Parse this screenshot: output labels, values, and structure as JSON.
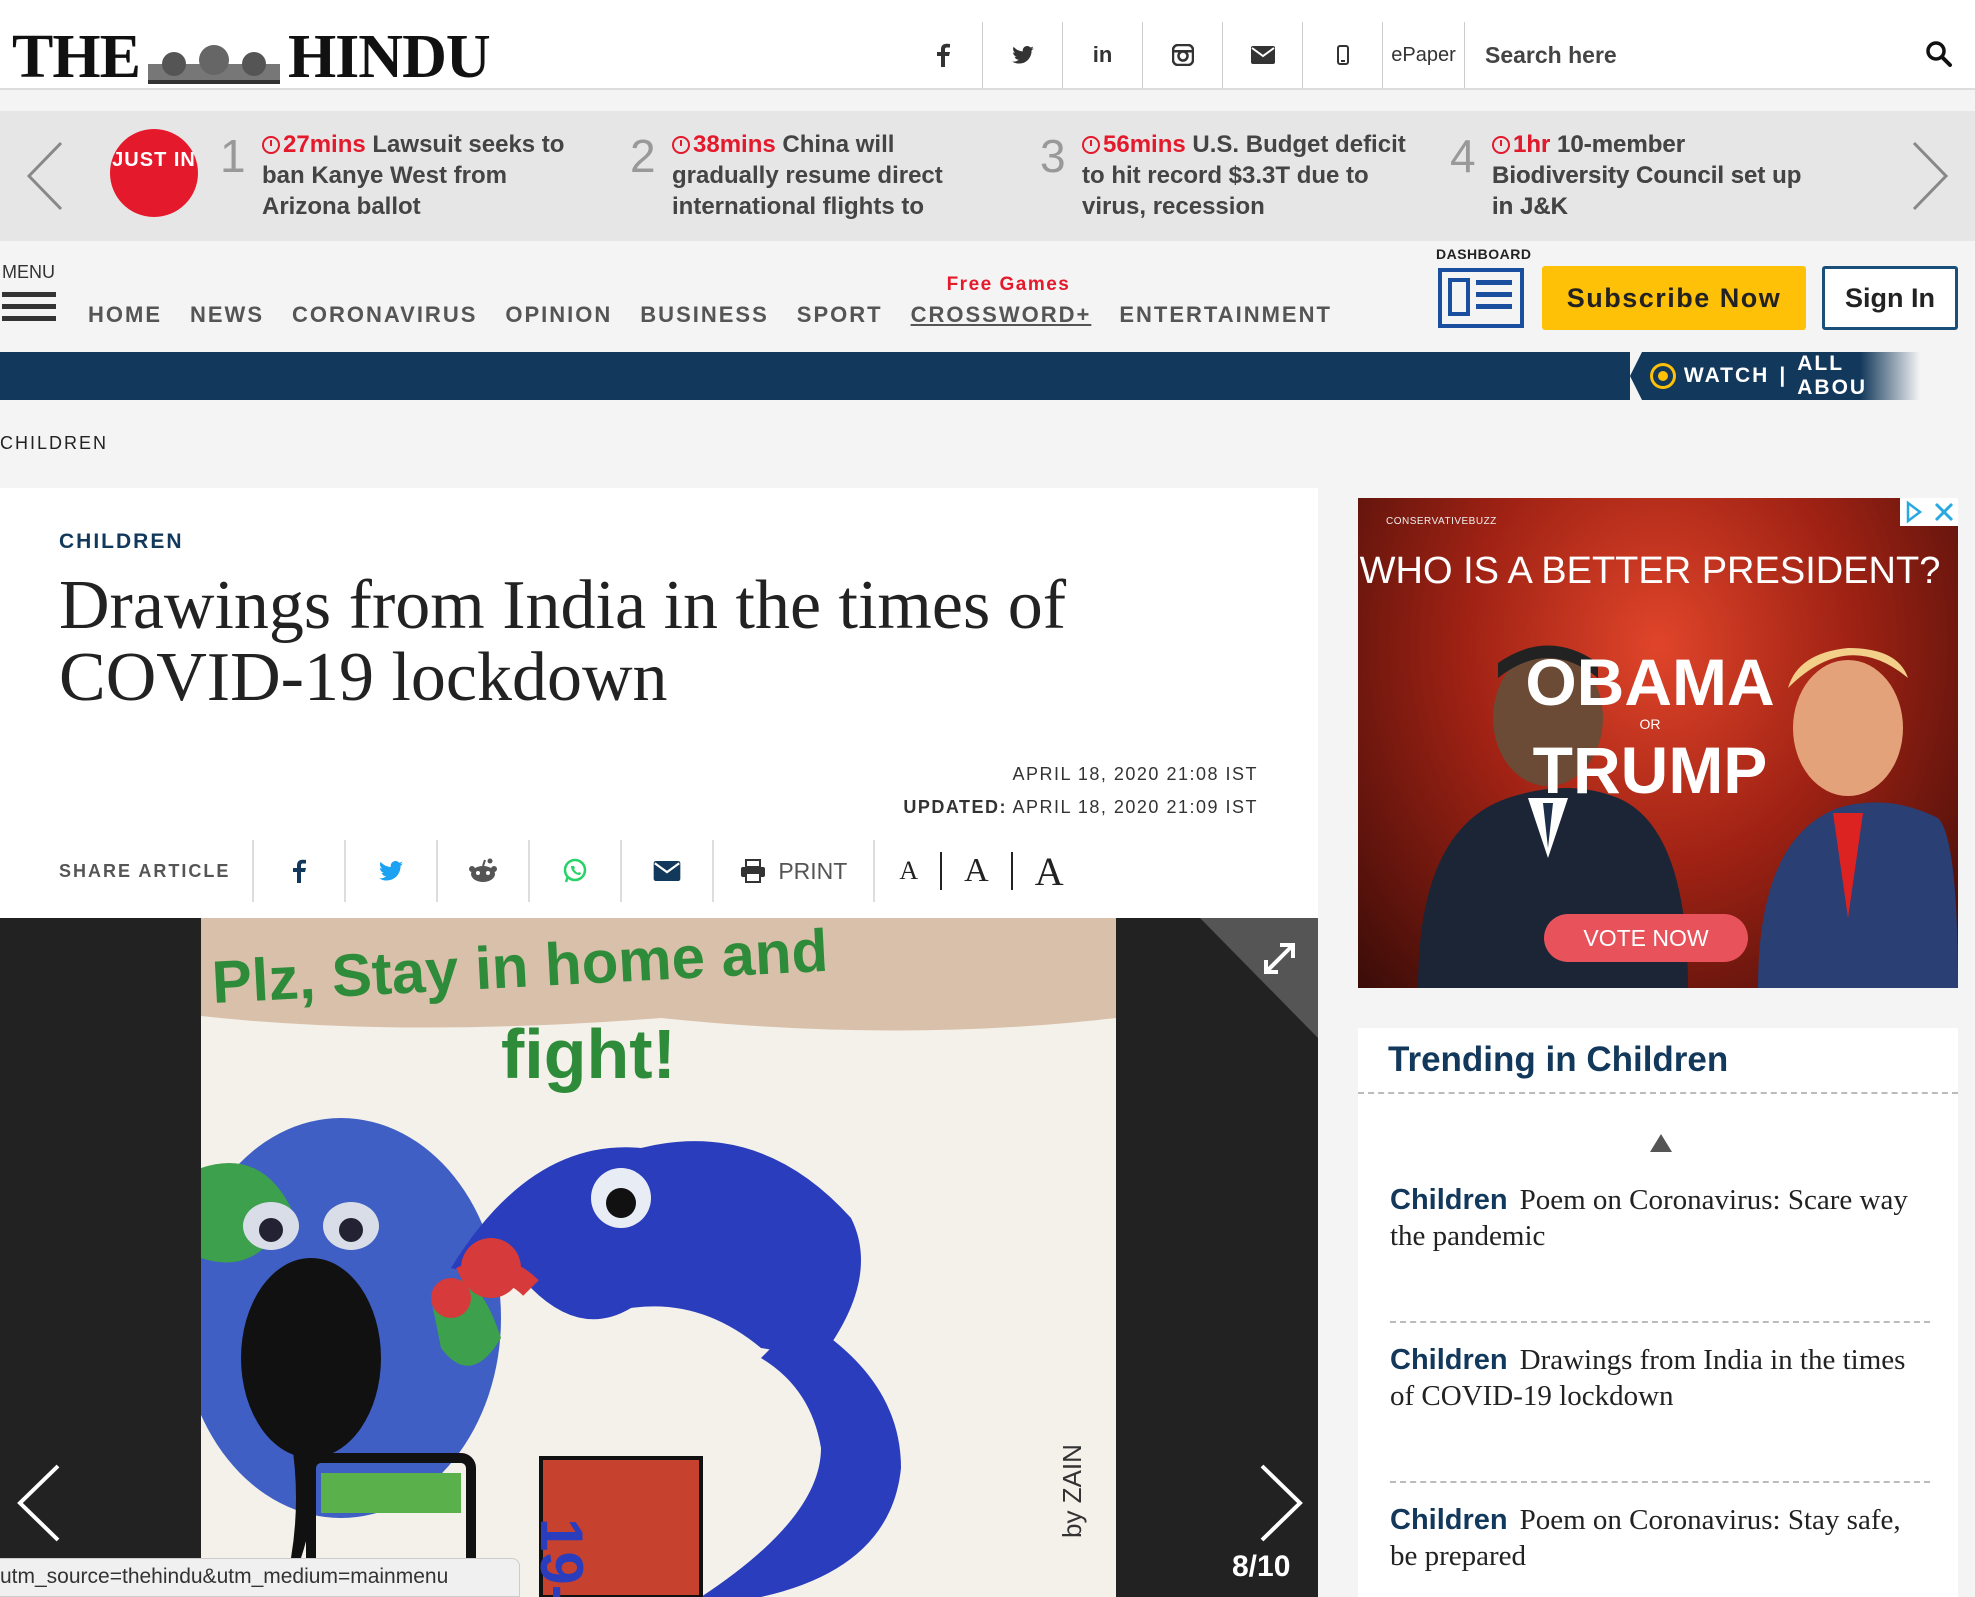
{
  "header": {
    "logo_left": "THE",
    "logo_right": "HINDU",
    "epaper": "ePaper",
    "search_placeholder": "Search here",
    "social_icons": [
      "facebook-icon",
      "twitter-icon",
      "linkedin-icon",
      "instagram-icon",
      "mail-icon",
      "mobile-icon"
    ]
  },
  "ticker": {
    "label": "JUST IN",
    "items": [
      {
        "num": "1",
        "time": "27mins",
        "text": "Lawsuit seeks to ban Kanye West from Arizona ballot"
      },
      {
        "num": "2",
        "time": "38mins",
        "text": "China will gradually resume direct international flights to"
      },
      {
        "num": "3",
        "time": "56mins",
        "text": "U.S. Budget deficit to hit record $3.3T due to virus, recession"
      },
      {
        "num": "4",
        "time": "1hr",
        "text": "10-member Biodiversity Council set up in J&K"
      }
    ]
  },
  "nav": {
    "menu_label": "MENU",
    "items": [
      "HOME",
      "NEWS",
      "CORONAVIRUS",
      "OPINION",
      "BUSINESS",
      "SPORT",
      "CROSSWORD+",
      "ENTERTAINMENT"
    ],
    "crossword_tag": "Free Games",
    "dashboard_label": "DASHBOARD",
    "subscribe": "Subscribe Now",
    "signin": "Sign In",
    "watch": "WATCH",
    "watch_more": "ALL ABOU"
  },
  "breadcrumb": "CHILDREN",
  "article": {
    "section": "CHILDREN",
    "title": "Drawings from India in the times of COVID-19 lockdown",
    "date": "APRIL 18, 2020 21:08 IST",
    "updated_label": "UPDATED:",
    "updated": "APRIL 18, 2020 21:09 IST",
    "share_label": "SHARE ARTICLE",
    "print_label": "PRINT",
    "font_sizes": [
      "A",
      "A",
      "A"
    ]
  },
  "gallery": {
    "counter": "8/10",
    "painting_text_1": "Plz, Stay in home and",
    "painting_text_2": "fight!",
    "painting_signature": "by ZAIN",
    "painting_book": "19-"
  },
  "statusbar": "utm_source=thehindu&utm_medium=mainmenu",
  "ad": {
    "brand": "CONSERVATIVEBUZZ",
    "question": "WHO IS A BETTER PRESIDENT?",
    "option1": "OBAMA",
    "or": "OR",
    "option2": "TRUMP",
    "cta": "VOTE NOW"
  },
  "trending": {
    "title": "Trending in Children",
    "items": [
      {
        "cat": "Children",
        "text": "Poem on Coronavirus: Scare way the pandemic"
      },
      {
        "cat": "Children",
        "text": "Drawings from India in the times of COVID-19 lockdown"
      },
      {
        "cat": "Children",
        "text": "Poem on Coronavirus: Stay safe, be prepared"
      }
    ]
  },
  "colors": {
    "brand_navy": "#12385b",
    "accent_red": "#e4192b",
    "subscribe_yellow": "#ffc107"
  }
}
